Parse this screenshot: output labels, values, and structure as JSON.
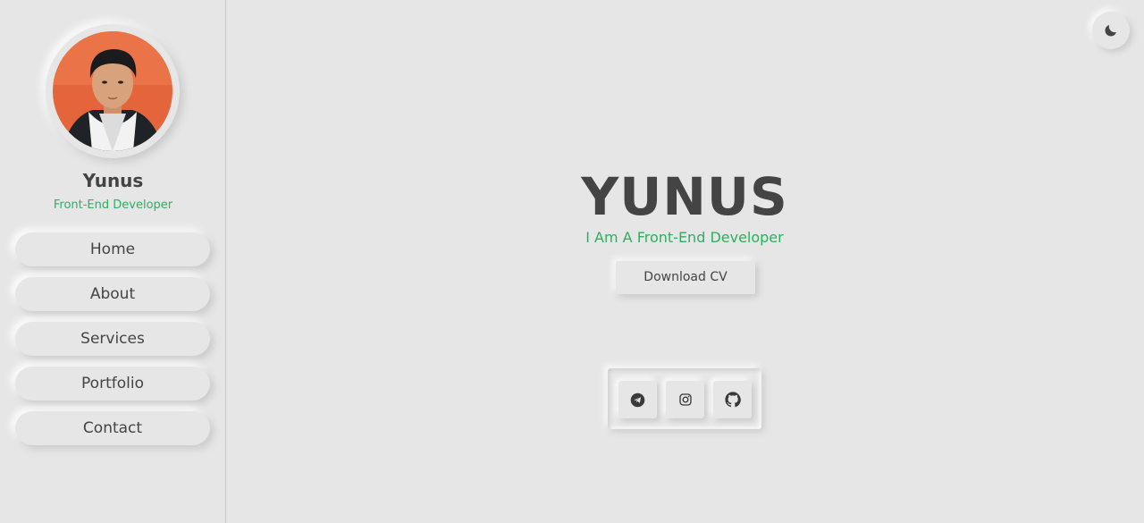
{
  "sidebar": {
    "profile": {
      "name": "Yunus",
      "role": "Front-End Developer",
      "avatar_icon": "profile-photo"
    },
    "nav": [
      {
        "label": "Home"
      },
      {
        "label": "About"
      },
      {
        "label": "Services"
      },
      {
        "label": "Portfolio"
      },
      {
        "label": "Contact"
      }
    ]
  },
  "header": {
    "theme_toggle_icon": "moon-icon"
  },
  "hero": {
    "title": "YUNUS",
    "subtitle": "I Am A Front-End Developer",
    "cta_label": "Download CV"
  },
  "social": [
    {
      "icon": "telegram-icon"
    },
    {
      "icon": "instagram-icon"
    },
    {
      "icon": "github-icon"
    }
  ],
  "colors": {
    "background": "#e6e6e6",
    "accent": "#2fae5f",
    "text": "#444444"
  }
}
